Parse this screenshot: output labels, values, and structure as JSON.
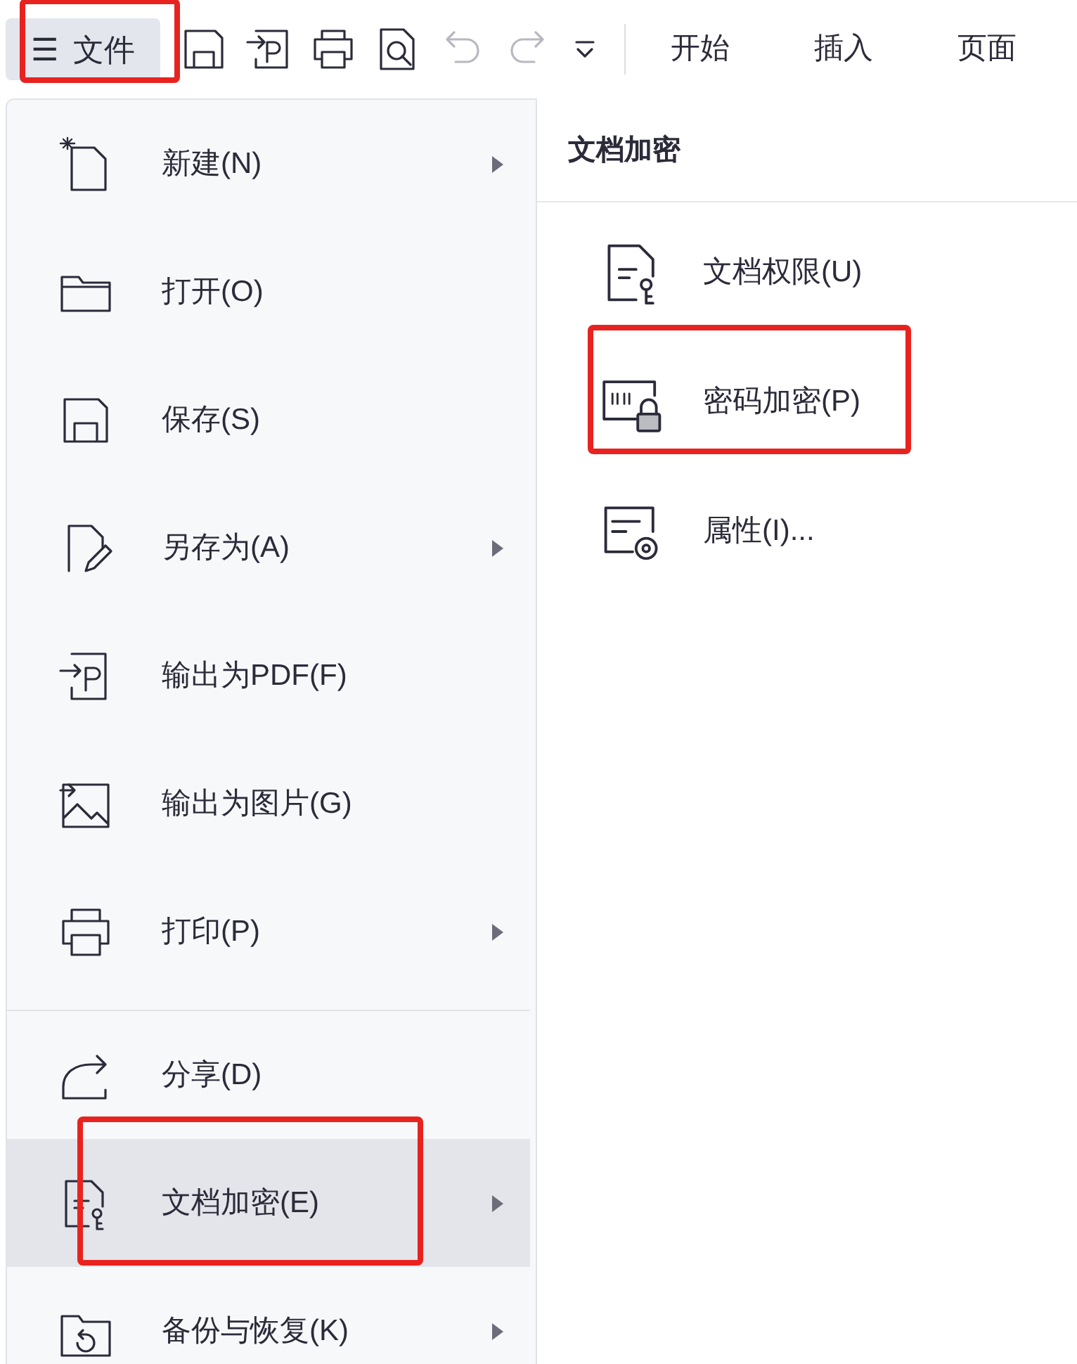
{
  "file_button": {
    "icon": "☰",
    "label": "文件",
    "annotated": true
  },
  "quick_access": [
    {
      "disabled": false
    },
    {
      "disabled": false
    },
    {
      "disabled": false
    },
    {
      "disabled": false
    },
    {
      "disabled": true
    },
    {
      "disabled": true
    },
    {
      "disabled": false
    }
  ],
  "ribbon_tabs": [
    {
      "label": "开始"
    },
    {
      "label": "插入"
    },
    {
      "label": "页面"
    }
  ],
  "file_menu": [
    {
      "label": "新建(N)",
      "submenu": true,
      "highlighted": false,
      "annotated": false,
      "separator_before": false
    },
    {
      "label": "打开(O)",
      "submenu": false,
      "highlighted": false,
      "annotated": false,
      "separator_before": false
    },
    {
      "label": "保存(S)",
      "submenu": false,
      "highlighted": false,
      "annotated": false,
      "separator_before": false
    },
    {
      "label": "另存为(A)",
      "submenu": true,
      "highlighted": false,
      "annotated": false,
      "separator_before": false
    },
    {
      "label": "输出为PDF(F)",
      "submenu": false,
      "highlighted": false,
      "annotated": false,
      "separator_before": false
    },
    {
      "label": "输出为图片(G)",
      "submenu": false,
      "highlighted": false,
      "annotated": false,
      "separator_before": false
    },
    {
      "label": "打印(P)",
      "submenu": true,
      "highlighted": false,
      "annotated": false,
      "separator_before": false
    },
    {
      "label": "分享(D)",
      "submenu": false,
      "highlighted": false,
      "annotated": false,
      "separator_before": true
    },
    {
      "label": "文档加密(E)",
      "submenu": true,
      "highlighted": true,
      "annotated": true,
      "separator_before": false
    },
    {
      "label": "备份与恢复(K)",
      "submenu": true,
      "highlighted": false,
      "annotated": false,
      "separator_before": false
    }
  ],
  "submenu": {
    "title": "文档加密",
    "items": [
      {
        "label": "文档权限(U)",
        "annotated": false
      },
      {
        "label": "密码加密(P)",
        "annotated": true
      },
      {
        "label": "属性(I)...",
        "annotated": false
      }
    ]
  }
}
